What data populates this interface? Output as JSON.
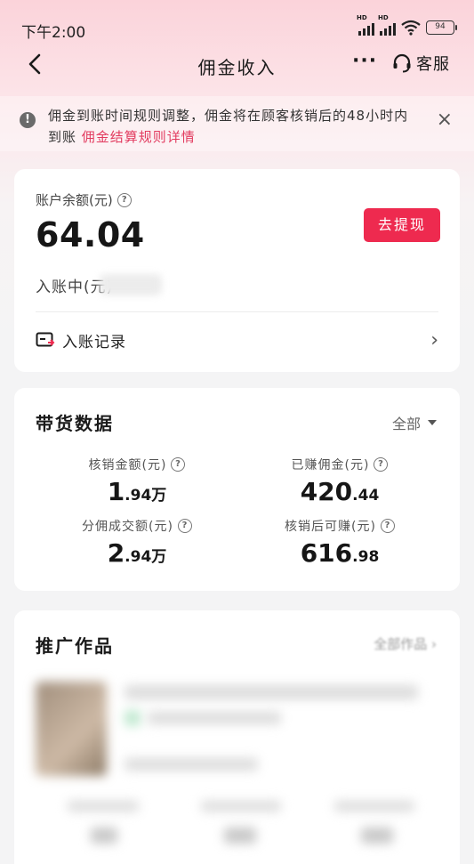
{
  "status_bar": {
    "time": "下午2:00",
    "hd_label": "HD",
    "battery": "94"
  },
  "nav": {
    "title": "佣金收入",
    "more_label": "···",
    "service_label": "客服"
  },
  "notice": {
    "text": "佣金到账时间规则调整，佣金将在顾客核销后的48小时内到账",
    "link": "佣金结算规则详情",
    "close": "×"
  },
  "balance": {
    "label": "账户余额(元)",
    "value": "64.04",
    "withdraw_label": "去提现",
    "pending_label": "入账中(元)",
    "records_label": "入账记录"
  },
  "sales_data": {
    "title": "带货数据",
    "filter": "全部",
    "metrics": [
      {
        "label": "核销金额(元)",
        "value_main": "1",
        "value_small": ".94",
        "unit": "万"
      },
      {
        "label": "已赚佣金(元)",
        "value_main": "420",
        "value_small": ".44",
        "unit": ""
      },
      {
        "label": "分佣成交额(元)",
        "value_main": "2",
        "value_small": ".94",
        "unit": "万"
      },
      {
        "label": "核销后可赚(元)",
        "value_main": "616",
        "value_small": ".98",
        "unit": ""
      }
    ]
  },
  "promo": {
    "title": "推广作品",
    "all_link": "全部作品 ›"
  },
  "colors": {
    "accent": "#ee2a4f",
    "link": "#e23b5f"
  }
}
